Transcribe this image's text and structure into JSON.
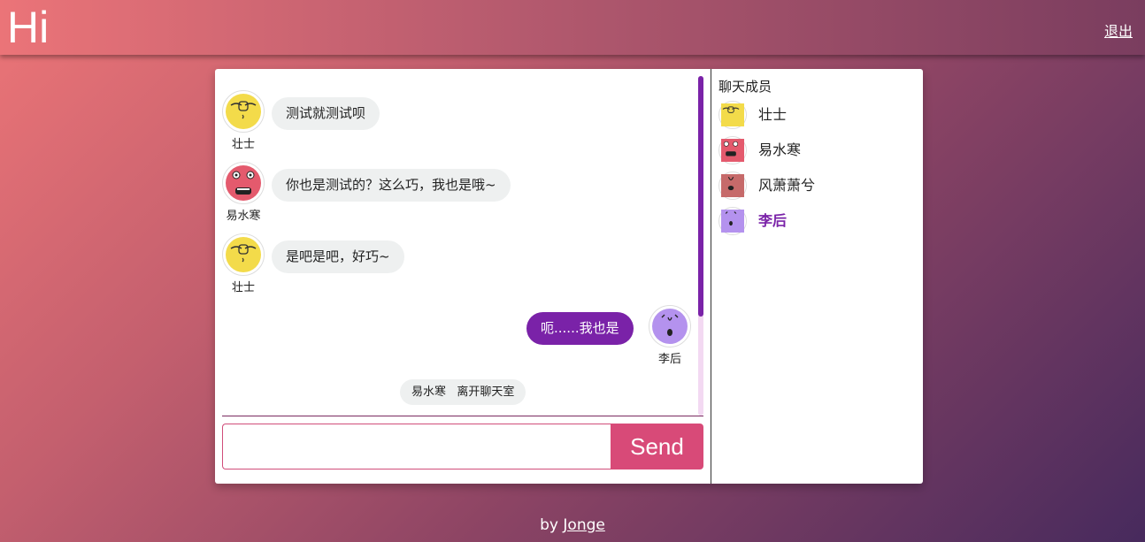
{
  "header": {
    "brand": "Hi",
    "logout_label": "退出"
  },
  "chat": {
    "messages": [
      {
        "user": "壮士",
        "text": "测试就测试呗",
        "avatar": "yellow-face-icon",
        "mine": false
      },
      {
        "user": "易水寒",
        "text": "你也是测试的？这么巧，我也是哦~",
        "avatar": "red-face-icon",
        "mine": false
      },
      {
        "user": "壮士",
        "text": "是吧是吧，好巧~",
        "avatar": "yellow-face-icon",
        "mine": false
      },
      {
        "user": "李后",
        "text": "呃......我也是",
        "avatar": "purple-face-icon",
        "mine": true
      }
    ],
    "system_notice": "易水寒   离开聊天室",
    "input_value": "",
    "input_placeholder": "",
    "send_label": "Send"
  },
  "members": {
    "title": "聊天成员",
    "list": [
      {
        "name": "壮士",
        "avatar": "yellow-face-icon",
        "me": false
      },
      {
        "name": "易水寒",
        "avatar": "red-face-icon",
        "me": false
      },
      {
        "name": "风萧萧兮",
        "avatar": "brown-face-icon",
        "me": false
      },
      {
        "name": "李后",
        "avatar": "purple-face-icon",
        "me": true
      }
    ]
  },
  "footer": {
    "prefix": "by",
    "author": "Jonge"
  },
  "colors": {
    "accent": "#7a22a8",
    "send": "#d84a78",
    "bubble": "#eef0f0"
  }
}
